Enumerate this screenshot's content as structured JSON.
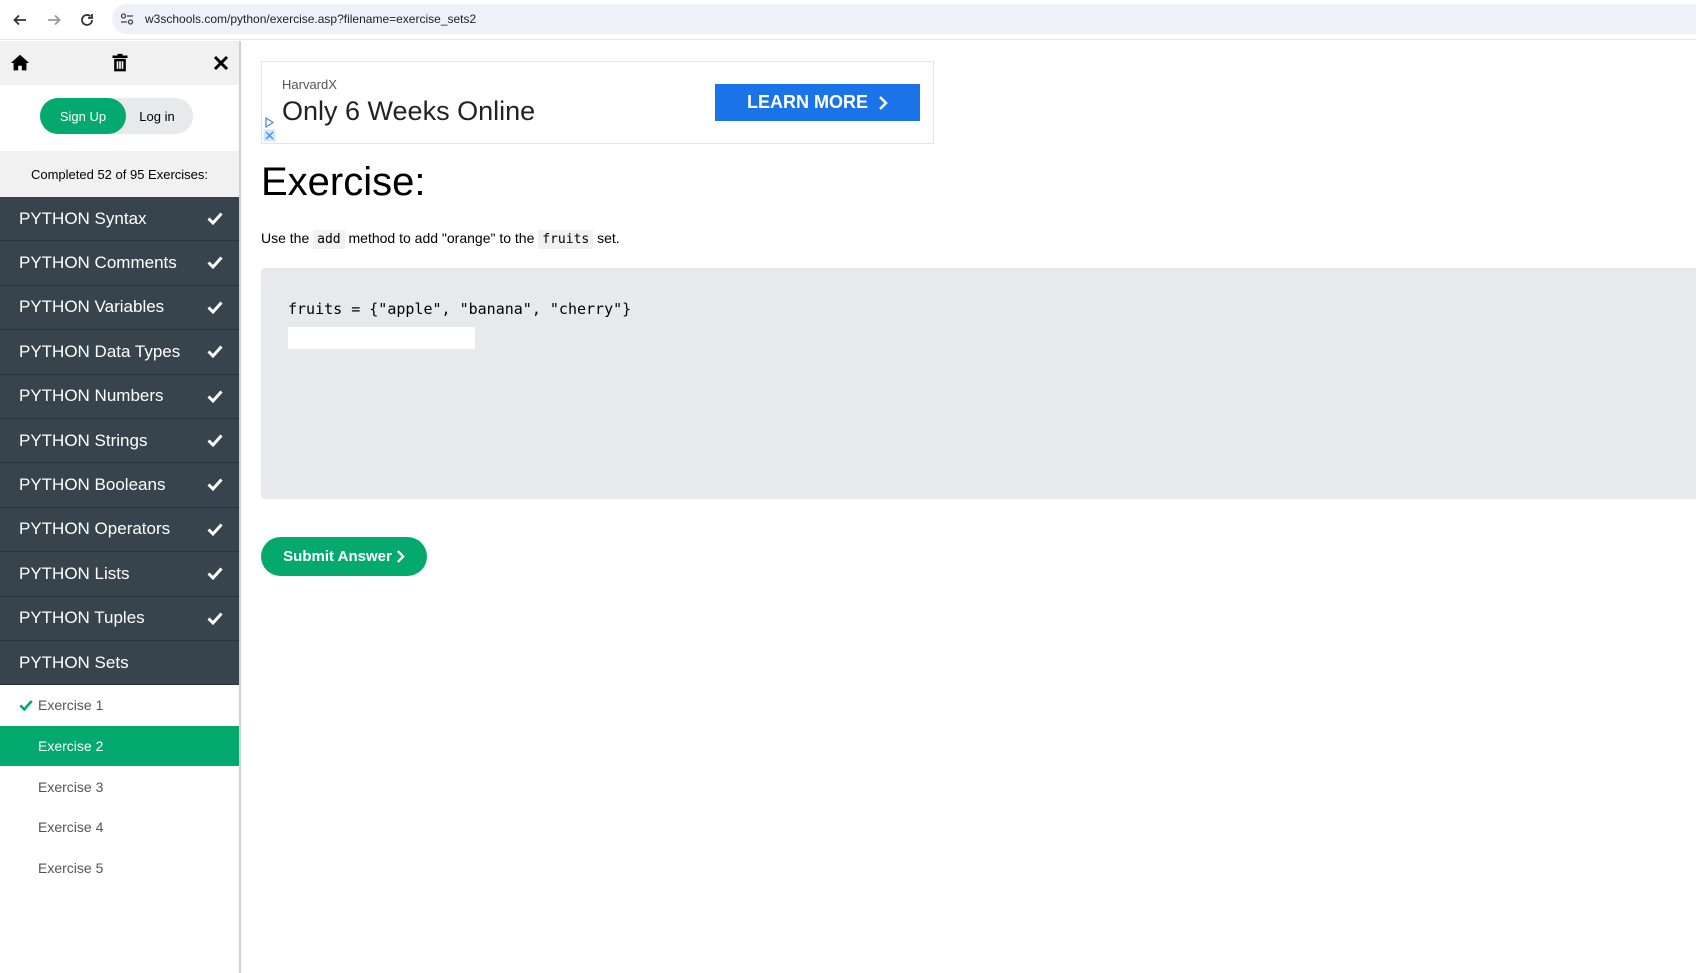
{
  "browser": {
    "url": "w3schools.com/python/exercise.asp?filename=exercise_sets2"
  },
  "sidebar": {
    "signup_label": "Sign Up",
    "login_label": "Log in",
    "progress": "Completed 52 of 95 Exercises:",
    "topics": [
      {
        "label": "PYTHON Syntax",
        "completed": true
      },
      {
        "label": "PYTHON Comments",
        "completed": true
      },
      {
        "label": "PYTHON Variables",
        "completed": true
      },
      {
        "label": "PYTHON Data Types",
        "completed": true
      },
      {
        "label": "PYTHON Numbers",
        "completed": true
      },
      {
        "label": "PYTHON Strings",
        "completed": true
      },
      {
        "label": "PYTHON Booleans",
        "completed": true
      },
      {
        "label": "PYTHON Operators",
        "completed": true
      },
      {
        "label": "PYTHON Lists",
        "completed": true
      },
      {
        "label": "PYTHON Tuples",
        "completed": true
      },
      {
        "label": "PYTHON Sets",
        "completed": false
      }
    ],
    "exercises": [
      {
        "label": "Exercise 1",
        "completed": true,
        "current": false
      },
      {
        "label": "Exercise 2",
        "completed": false,
        "current": true
      },
      {
        "label": "Exercise 3",
        "completed": false,
        "current": false
      },
      {
        "label": "Exercise 4",
        "completed": false,
        "current": false
      },
      {
        "label": "Exercise 5",
        "completed": false,
        "current": false
      }
    ]
  },
  "ad": {
    "brand": "HarvardX",
    "headline": "Only 6 Weeks Online",
    "cta": "LEARN MORE"
  },
  "exercise": {
    "title": "Exercise:",
    "instruction_prefix": "Use the ",
    "instruction_code1": "add",
    "instruction_middle": " method to add \"orange\" to the ",
    "instruction_code2": "fruits",
    "instruction_suffix": " set.",
    "code_line": "fruits = {\"apple\", \"banana\", \"cherry\"}",
    "answer_value": "",
    "submit_label": "Submit Answer"
  },
  "colors": {
    "accent_green": "#04aa6d",
    "sidebar_dark": "#38444d",
    "ad_blue": "#1a73e8"
  }
}
